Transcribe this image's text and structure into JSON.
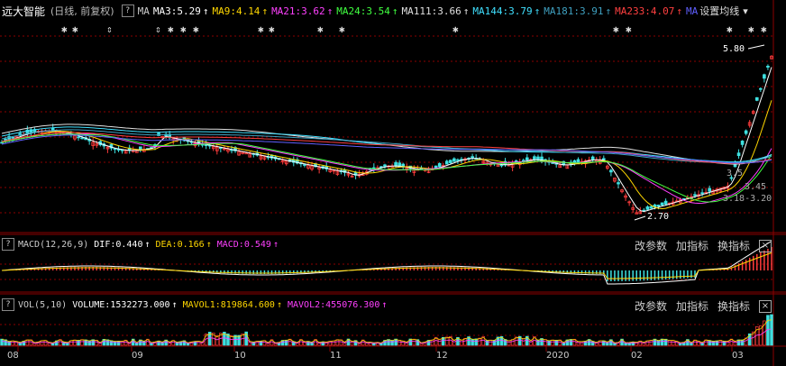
{
  "stock": {
    "name": "远大智能",
    "period": "(日线, 前复权)",
    "help": "?",
    "ma_label": "MA"
  },
  "ma_legend": [
    {
      "label": "MA3:5.29",
      "color": "#ffffff"
    },
    {
      "label": "MA9:4.14",
      "color": "#ffd700"
    },
    {
      "label": "MA21:3.62",
      "color": "#ff40ff"
    },
    {
      "label": "MA24:3.54",
      "color": "#40ff40"
    },
    {
      "label": "MA111:3.66",
      "color": "#e0e0e0"
    },
    {
      "label": "MA144:3.79",
      "color": "#40e0ff"
    },
    {
      "label": "MA181:3.91",
      "color": "#3fa0c0"
    },
    {
      "label": "MA233:4.07",
      "color": "#ff4040"
    },
    {
      "label": "MA",
      "color": "#6060ff"
    }
  ],
  "settings_label": "设置均线",
  "dropdown_glyph": "▾",
  "price_annotations": {
    "high": "5.80",
    "low": "2.70",
    "mid1": "3.5",
    "mid2": "3.45",
    "mid3": "3.18-3.20"
  },
  "macd_panel": {
    "name": "MACD(12,26,9)",
    "dif": "DIF:0.440",
    "dea": "DEA:0.166",
    "macd": "MACD:0.549",
    "dif_color": "#ffffff",
    "dea_color": "#ffd700",
    "macd_color": "#ff40ff"
  },
  "vol_panel": {
    "name": "VOL(5,10)",
    "volume": "VOLUME:1532273.000",
    "mavol1": "MAVOL1:819864.600",
    "mavol2": "MAVOL2:455076.300",
    "vol_color": "#ffffff",
    "mavol1_color": "#ffd700",
    "mavol2_color": "#ff40ff"
  },
  "panel_tools": {
    "change_params": "改参数",
    "add_indicator": "加指标",
    "switch_indicator": "换指标",
    "close": "×"
  },
  "x_axis_labels": [
    "08",
    "09",
    "10",
    "11",
    "12",
    "2020",
    "02",
    "03"
  ],
  "arrow_up": "↑",
  "star": "✱",
  "updown": "⇕",
  "colors": {
    "up": "#ff3c3c",
    "down": "#3ee0e0",
    "grid": "#8b0000",
    "bg": "#000000"
  }
}
